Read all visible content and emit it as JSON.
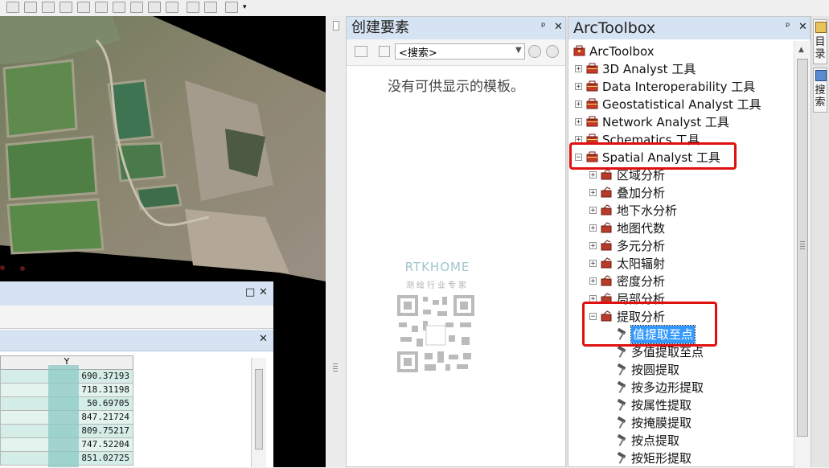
{
  "create_features": {
    "title": "创建要素",
    "search_placeholder": "<搜索>",
    "empty_message": "没有可供显示的模板。",
    "watermark_brand": "RTKHOME",
    "watermark_tagline": "测绘行业专家",
    "pin_symbol": "ᵖ",
    "close_symbol": "✕"
  },
  "arctoolbox": {
    "title": "ArcToolbox",
    "pin_symbol": "ᵖ",
    "close_symbol": "✕",
    "root_label": "ArcToolbox",
    "toolboxes": [
      {
        "label": "3D Analyst 工具",
        "state": "+"
      },
      {
        "label": "Data Interoperability 工具",
        "state": "+"
      },
      {
        "label": "Geostatistical Analyst 工具",
        "state": "+"
      },
      {
        "label": "Network Analyst 工具",
        "state": "+"
      },
      {
        "label": "Schematics 工具",
        "state": "+"
      },
      {
        "label": "Spatial Analyst 工具",
        "state": "−"
      }
    ],
    "toolsets": [
      {
        "label": "区域分析",
        "state": "+"
      },
      {
        "label": "叠加分析",
        "state": "+"
      },
      {
        "label": "地下水分析",
        "state": "+"
      },
      {
        "label": "地图代数",
        "state": "+"
      },
      {
        "label": "多元分析",
        "state": "+"
      },
      {
        "label": "太阳辐射",
        "state": "+"
      },
      {
        "label": "密度分析",
        "state": "+"
      },
      {
        "label": "局部分析",
        "state": "+"
      },
      {
        "label": "提取分析",
        "state": "−"
      }
    ],
    "tools": [
      {
        "label": "值提取至点",
        "selected": true
      },
      {
        "label": "多值提取至点"
      },
      {
        "label": "按圆提取"
      },
      {
        "label": "按多边形提取"
      },
      {
        "label": "按属性提取"
      },
      {
        "label": "按掩膜提取"
      },
      {
        "label": "按点提取"
      },
      {
        "label": "按矩形提取"
      }
    ]
  },
  "dock_tabs": [
    "目录",
    "搜索"
  ],
  "attribute_table": {
    "column_header": "Y",
    "maximize_symbol": "□",
    "close_symbol": "✕",
    "values": [
      "690.37193",
      "718.31198",
      "50.69705",
      "847.21724",
      "809.75217",
      "747.52204",
      "851.02725"
    ]
  },
  "colors": {
    "title_bar": "#d6e3f3",
    "highlight_red": "#e01010",
    "selection_blue": "#3399ff"
  }
}
